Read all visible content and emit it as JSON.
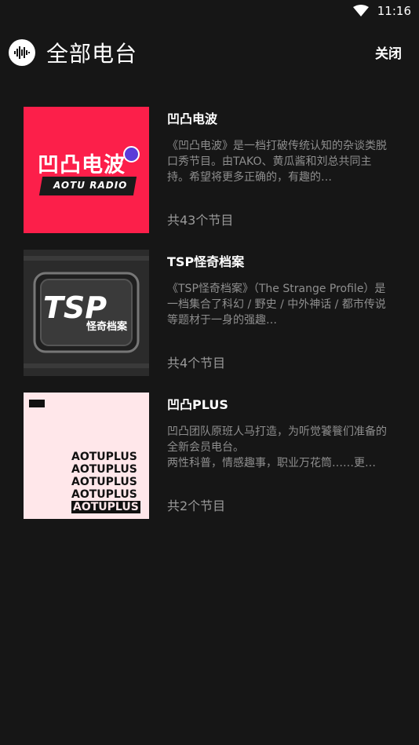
{
  "status_bar": {
    "time": "11:16"
  },
  "header": {
    "title": "全部电台",
    "close_label": "关闭"
  },
  "stations": [
    {
      "name": "凹凸电波",
      "description": "《凹凸电波》是一档打破传统认知的杂谈类脱口秀节目。由TAKO、黄瓜酱和刘总共同主持。希望将更多正确的，有趣的…",
      "count": "共43个节目",
      "cover_title": "凹凸电波",
      "cover_subtitle": "AOTU RADIO"
    },
    {
      "name": "TSP怪奇档案",
      "description": "《TSP怪奇档案》（The Strange Profile）是一档集合了科幻 / 野史 / 中外神话 / 都市传说 等题材于一身的强趣…",
      "count": "共4个节目",
      "cover_title": "TSP",
      "cover_subtitle": "怪奇档案"
    },
    {
      "name": "凹凸PLUS",
      "description": "凹凸团队原班人马打造，为听觉饕餮们准备的全新会员电台。\n两性科普，情感趣事，职业万花筒……更…",
      "count": "共2个节目",
      "cover_lines": [
        "AOTUPLUS",
        "AOTUPLUS",
        "AOTUPLUS",
        "AOTUPLUS",
        "AOTUPLUS"
      ]
    }
  ],
  "colors": {
    "background": "#161616",
    "aotu_red": "#fc1f4a",
    "plus_pink": "#ffe7ea"
  }
}
